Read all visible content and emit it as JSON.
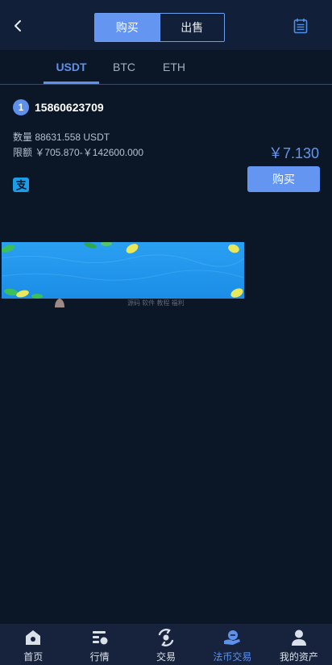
{
  "header": {
    "segments": [
      {
        "label": "购买",
        "active": true
      },
      {
        "label": "出售",
        "active": false
      }
    ],
    "back_icon": "chevron-left-icon",
    "calendar_icon": "calendar-icon"
  },
  "tabs": [
    {
      "label": "USDT",
      "active": true
    },
    {
      "label": "BTC",
      "active": false
    },
    {
      "label": "ETH",
      "active": false
    }
  ],
  "listing": {
    "avatar_text": "1",
    "user": "15860623709",
    "quantity": "数量 88631.558 USDT",
    "limit": "限额 ￥705.870-￥142600.000",
    "price": "￥7.130",
    "payment_icon": "alipay-icon",
    "buy_label": "购买"
  },
  "watermark": "源码 软件 教程 福利",
  "tabbar": [
    {
      "label": "首页",
      "icon": "home-icon",
      "active": false
    },
    {
      "label": "行情",
      "icon": "market-icon",
      "active": false
    },
    {
      "label": "交易",
      "icon": "trade-icon",
      "active": false
    },
    {
      "label": "法币交易",
      "icon": "fiat-trade-icon",
      "active": true
    },
    {
      "label": "我的资产",
      "icon": "user-icon",
      "active": false
    }
  ],
  "colors": {
    "accent": "#5e90ec",
    "background": "#0b1726",
    "header": "#121f38",
    "tabbar": "#17233d"
  }
}
